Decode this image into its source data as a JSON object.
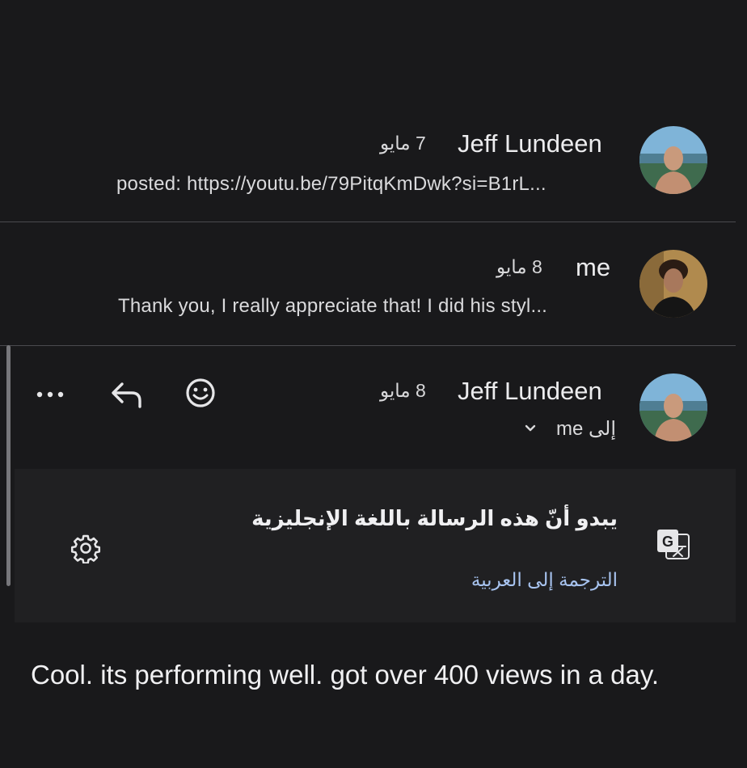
{
  "messages": [
    {
      "sender": "Jeff Lundeen",
      "date": "7 مايو",
      "snippet": "posted: https://youtu.be/79PitqKmDwk?si=B1rL..."
    },
    {
      "sender": "me",
      "date": "8 مايو",
      "snippet": "Thank you, I really appreciate that! I did his styl..."
    }
  ],
  "open_message": {
    "sender": "Jeff Lundeen",
    "date": "8 مايو",
    "recipient": "إلى me",
    "actions": [
      "more-options",
      "reply",
      "emoji-react"
    ],
    "translate_banner": {
      "title": "يبدو أنّ هذه الرسالة باللغة الإنجليزية",
      "link": "الترجمة إلى العربية"
    },
    "body": "Cool.  its performing well.  got over 400 views in a day."
  },
  "colors": {
    "background": "#19191b",
    "panel": "#202022",
    "link": "#a8c4f0",
    "divider": "#4a4a4e"
  }
}
